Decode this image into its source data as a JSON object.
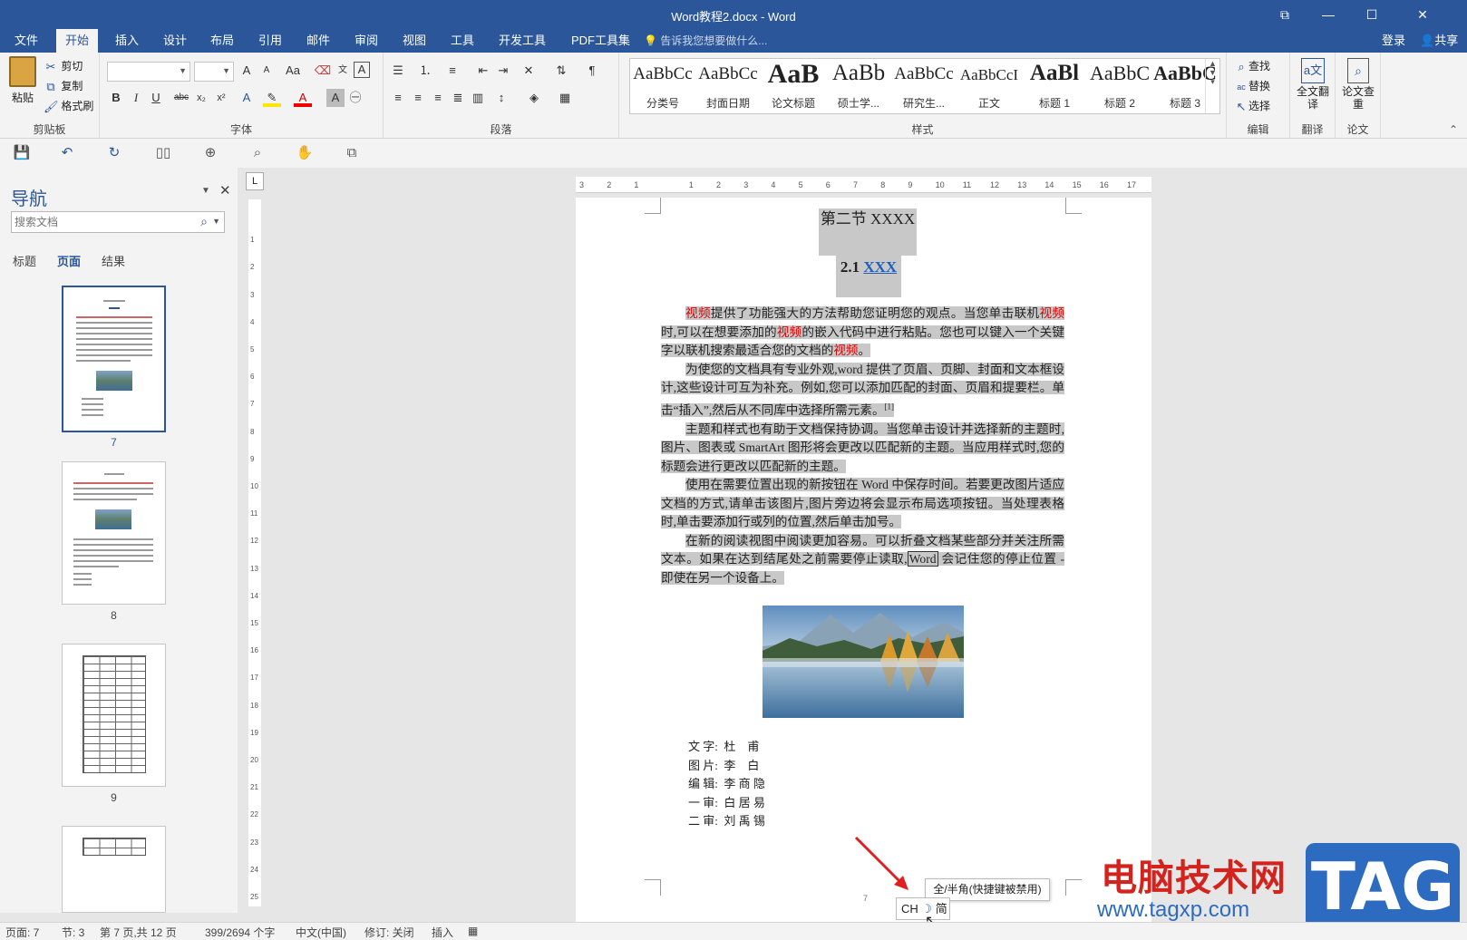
{
  "title": "Word教程2.docx - Word",
  "ribbon_tabs": [
    "文件",
    "开始",
    "插入",
    "设计",
    "布局",
    "引用",
    "邮件",
    "审阅",
    "视图",
    "工具",
    "开发工具",
    "PDF工具集"
  ],
  "active_tab": "开始",
  "tell_me": "告诉我您想要做什么...",
  "login": "登录",
  "share": "共享",
  "clipboard": {
    "paste": "粘贴",
    "cut": "剪切",
    "copy": "复制",
    "format_painter": "格式刷",
    "label": "剪贴板"
  },
  "font": {
    "label": "字体",
    "grow": "A",
    "shrink": "A",
    "case": "Aa"
  },
  "paragraph": {
    "label": "段落"
  },
  "styles": {
    "label": "样式",
    "items": [
      {
        "sample": "AaBbCc",
        "name": "分类号"
      },
      {
        "sample": "AaBbCc",
        "name": "封面日期"
      },
      {
        "sample": "AaB",
        "name": "论文标题"
      },
      {
        "sample": "AaBb",
        "name": "硕士学..."
      },
      {
        "sample": "AaBbCc",
        "name": "研究生..."
      },
      {
        "sample": "AaBbCcI",
        "name": "正文"
      },
      {
        "sample": "AaBl",
        "name": "标题 1"
      },
      {
        "sample": "AaBbC",
        "name": "标题 2"
      },
      {
        "sample": "AaBbC",
        "name": "标题 3"
      }
    ]
  },
  "editing": {
    "find": "查找",
    "replace": "替换",
    "select": "选择",
    "label": "编辑"
  },
  "translate": {
    "button": "全文翻译",
    "label": "翻译"
  },
  "paper": {
    "button": "论文查重",
    "label": "论文"
  },
  "nav": {
    "title": "导航",
    "search_placeholder": "搜索文档",
    "tabs": [
      "标题",
      "页面",
      "结果"
    ],
    "active_tab": "页面",
    "pages": [
      "7",
      "8",
      "9"
    ]
  },
  "doc": {
    "heading1": "第二节  XXXX",
    "heading2_prefix": "2.1 ",
    "heading2_link": "XXX",
    "p1": [
      "视频",
      "提供了功能强大的方法帮助您证明您的观点。当您单击联机",
      "视频",
      "时,可以在想要添加的",
      "视频",
      "的嵌入代码中进行粘贴。您也可以键入一个关键字以联机搜索最适合您的文档的",
      "视频",
      "。"
    ],
    "p2": "为使您的文档具有专业外观,word 提供了页眉、页脚、封面和文本框设计,这些设计可互为补充。例如,您可以添加匹配的封面、页眉和提要栏。单击“插入”,然后从不同库中选择所需元素。",
    "p2_note": "[1]",
    "p3": "主题和样式也有助于文档保持协调。当您单击设计并选择新的主题时,图片、图表或 SmartArt 图形将会更改以匹配新的主题。当应用样式时,您的标题会进行更改以匹配新的主题。",
    "p4": "使用在需要位置出现的新按钮在 Word 中保存时间。若要更改图片适应文档的方式,请单击该图片,图片旁边将会显示布局选项按钮。当处理表格时,单击要添加行或列的位置,然后单击加号。",
    "p5a": "在新的阅读视图中阅读更加容易。可以折叠文档某些部分并关注所需文本。如果在达到结尾处之前需要停止读取,",
    "p5_boxed": "Word",
    "p5b": " 会记住您的停止位置 - 即使在另一个设备上。",
    "credits": [
      {
        "role": "文 字:",
        "name": "杜    甫"
      },
      {
        "role": "图 片:",
        "name": "李    白"
      },
      {
        "role": "编 辑:",
        "name": "李 商 隐"
      },
      {
        "role": "一 审:",
        "name": "白 居 易"
      },
      {
        "role": "二 审:",
        "name": "刘 禹 锡"
      }
    ],
    "page_number": "7"
  },
  "ime": {
    "lang": "CH",
    "mode": "简"
  },
  "tooltip": "全/半角(快捷键被禁用)",
  "watermark": {
    "cn": "电脑技术网",
    "url": "www.tagxp.com",
    "tag": "TAG"
  },
  "status": {
    "page": "页面: 7",
    "section": "节: 3",
    "pageof": "第 7 页,共 12 页",
    "words": "399/2694 个字",
    "lang": "中文(中国)",
    "track": "修订: 关闭",
    "insert": "插入"
  },
  "colors": {
    "brand": "#2b579a",
    "highlight": "#c8c8c8",
    "red_text": "#dd0000"
  }
}
